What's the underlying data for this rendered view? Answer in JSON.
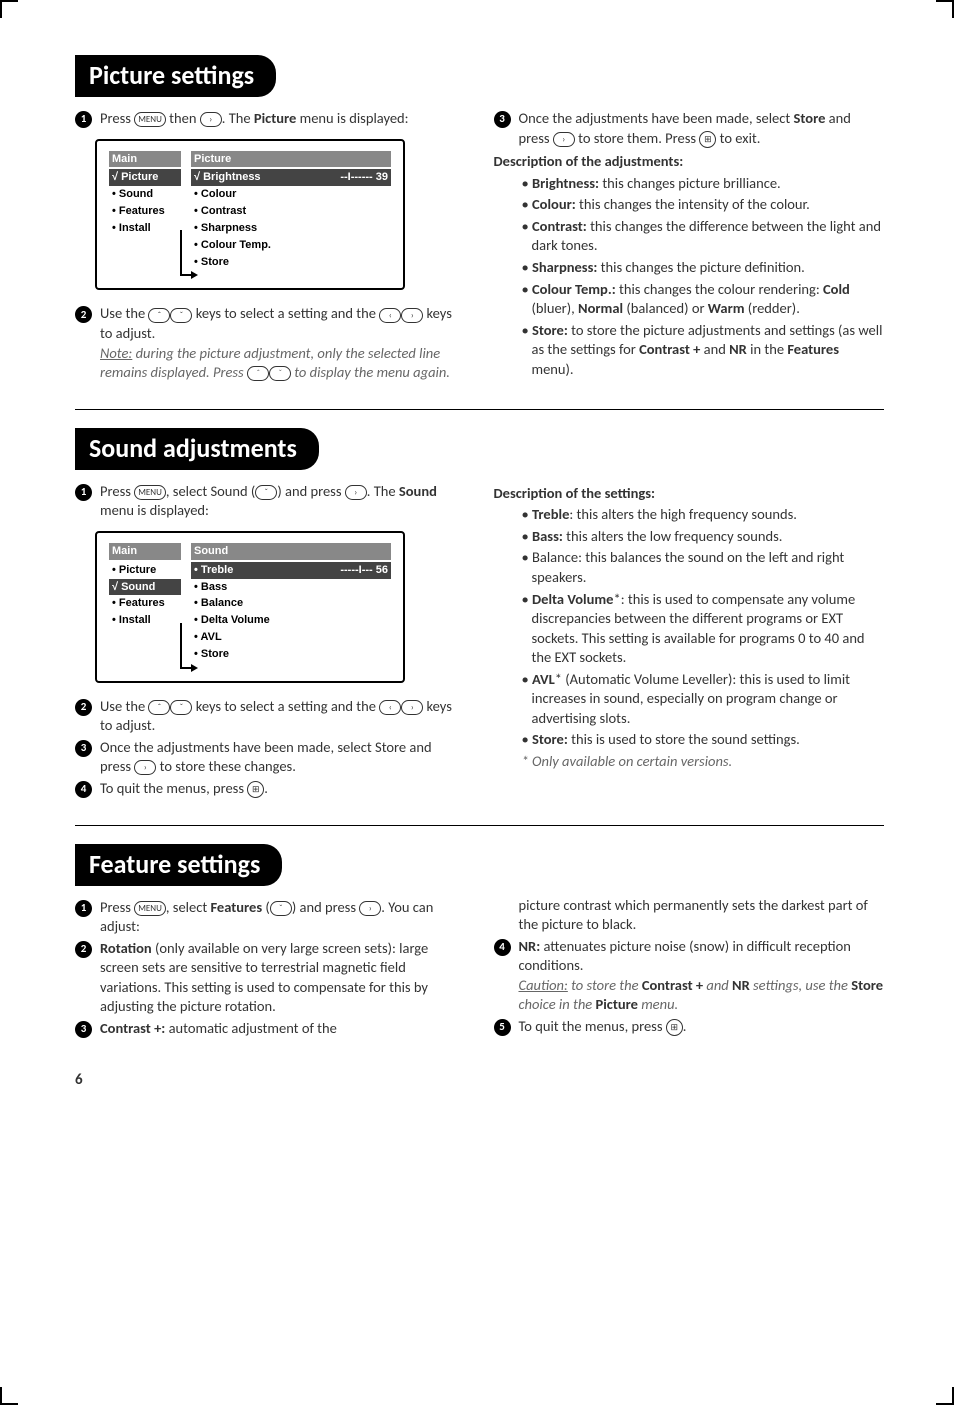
{
  "picture": {
    "heading": "Picture settings",
    "step1_a": "Press ",
    "step1_b": " then ",
    "step1_c": ". The ",
    "step1_word": "Picture",
    "step1_d": " menu is displayed:",
    "osd_main_title": "Main",
    "osd_main_items": [
      "√ Picture",
      "• Sound",
      "• Features",
      "• Install"
    ],
    "osd_sub_title": "Picture",
    "osd_brightness_label": "√ Brightness",
    "osd_brightness_val": "--I------ 39",
    "osd_sub_items": [
      "• Colour",
      "• Contrast",
      "• Sharpness",
      "• Colour Temp.",
      "• Store"
    ],
    "step2_a": "Use the ",
    "step2_b": " keys to select a setting and the ",
    "step2_c": " keys to adjust.",
    "note_label": "Note:",
    "note_body_a": " during the picture adjustment, only the selected line remains displayed. Press ",
    "note_body_b": " to display the menu again.",
    "step3_a": "Once the adjustments have been made, select ",
    "step3_store": "Store",
    "step3_b": " and press ",
    "step3_c": " to store them. Press ",
    "step3_d": " to exit.",
    "desc_head": "Description of the adjustments:",
    "bullets": [
      {
        "t": "Brightness:",
        "b": " this changes picture brilliance."
      },
      {
        "t": "Colour:",
        "b": " this changes the intensity of the colour."
      },
      {
        "t": "Contrast:",
        "b": " this changes the difference between the light and dark tones."
      },
      {
        "t": "Sharpness:",
        "b": " this changes the picture definition."
      },
      {
        "t": "Colour Temp.:",
        "b": " this changes the colour rendering: ",
        "extra": [
          [
            "Cold",
            " (bluer), "
          ],
          [
            "Normal",
            " (balanced) or "
          ],
          [
            "Warm",
            " (redder)."
          ]
        ]
      },
      {
        "t": "Store:",
        "b": " to store the picture adjustments and settings (as well as the settings for ",
        "extra2": [
          [
            "Contrast +",
            " and "
          ],
          [
            "NR",
            " in the "
          ],
          [
            "Features",
            " menu)."
          ]
        ]
      }
    ]
  },
  "sound": {
    "heading": "Sound adjustments",
    "step1_a": "Press ",
    "step1_b": ", select Sound (",
    "step1_c": ") and press ",
    "step1_d": ". The ",
    "step1_word": "Sound",
    "step1_e": " menu is displayed:",
    "osd_main_title": "Main",
    "osd_main_items": [
      "• Picture",
      "√ Sound",
      "• Features",
      "• Install"
    ],
    "osd_sub_title": "Sound",
    "osd_treble_label": "• Treble",
    "osd_treble_val": "-----I--- 56",
    "osd_sub_items": [
      "• Bass",
      "• Balance",
      "• Delta Volume",
      "• AVL",
      "• Store"
    ],
    "step2_a": "Use the ",
    "step2_b": " keys to select a setting and the ",
    "step2_c": " keys to adjust.",
    "step3": "Once the adjustments have been made, select Store and press ",
    "step3_b": " to store these changes.",
    "step4": "To quit the menus, press ",
    "step4_b": ".",
    "desc_head": "Description of the settings:",
    "b_treble_t": "Treble",
    "b_treble_b": ": this alters the high frequency sounds.",
    "b_bass_t": "Bass:",
    "b_bass_b": " this alters the low frequency sounds.",
    "b_balance": "Balance: this balances the sound on the left and right speakers.",
    "b_delta_t": "Delta Volume",
    "b_delta_b": "*: this is used to compensate any volume discrepancies between the different programs or EXT sockets. This setting is available for programs 0 to 40 and the EXT sockets.",
    "b_avl_t": "AVL",
    "b_avl_b": "* (Automatic Volume Leveller): this is used to limit increases in sound, especially on program change or advertising slots.",
    "b_store_t": "Store:",
    "b_store_b": " this is used to store the sound settings.",
    "footnote": "* Only available on certain versions."
  },
  "feature": {
    "heading": "Feature settings",
    "step1_a": "Press ",
    "step1_b": ", select ",
    "step1_word": "Features",
    "step1_c": " (",
    "step1_d": ") and press ",
    "step1_e": ". You can adjust:",
    "step2_t": "Rotation",
    "step2_b": " (only available on very large screen sets): large screen sets are sensitive to terrestrial magnetic field variations. This setting is used to compensate for this by adjusting the picture rotation.",
    "step3_t": "Contrast +:",
    "step3_b": " automatic adjustment of the",
    "right_cont": "picture contrast which permanently sets the darkest part of the picture to black.",
    "step4_t": "NR:",
    "step4_b": " attenuates picture noise (snow) in difficult reception conditions.",
    "caution_label": "Caution:",
    "caution_a": " to store the ",
    "caution_cp": "Contrast +",
    "caution_b": " and ",
    "caution_nr": "NR",
    "caution_c": " settings, use the ",
    "caution_store": "Store",
    "caution_d": " choice in the ",
    "caution_pic": "Picture",
    "caution_e": " menu.",
    "step5": "To quit the menus, press ",
    "step5_b": "."
  },
  "page_number": "6",
  "btn": {
    "menu": "MENU",
    "right": "›",
    "left": "‹",
    "up": "ˆ",
    "down": "ˇ",
    "exit": "⊞"
  }
}
